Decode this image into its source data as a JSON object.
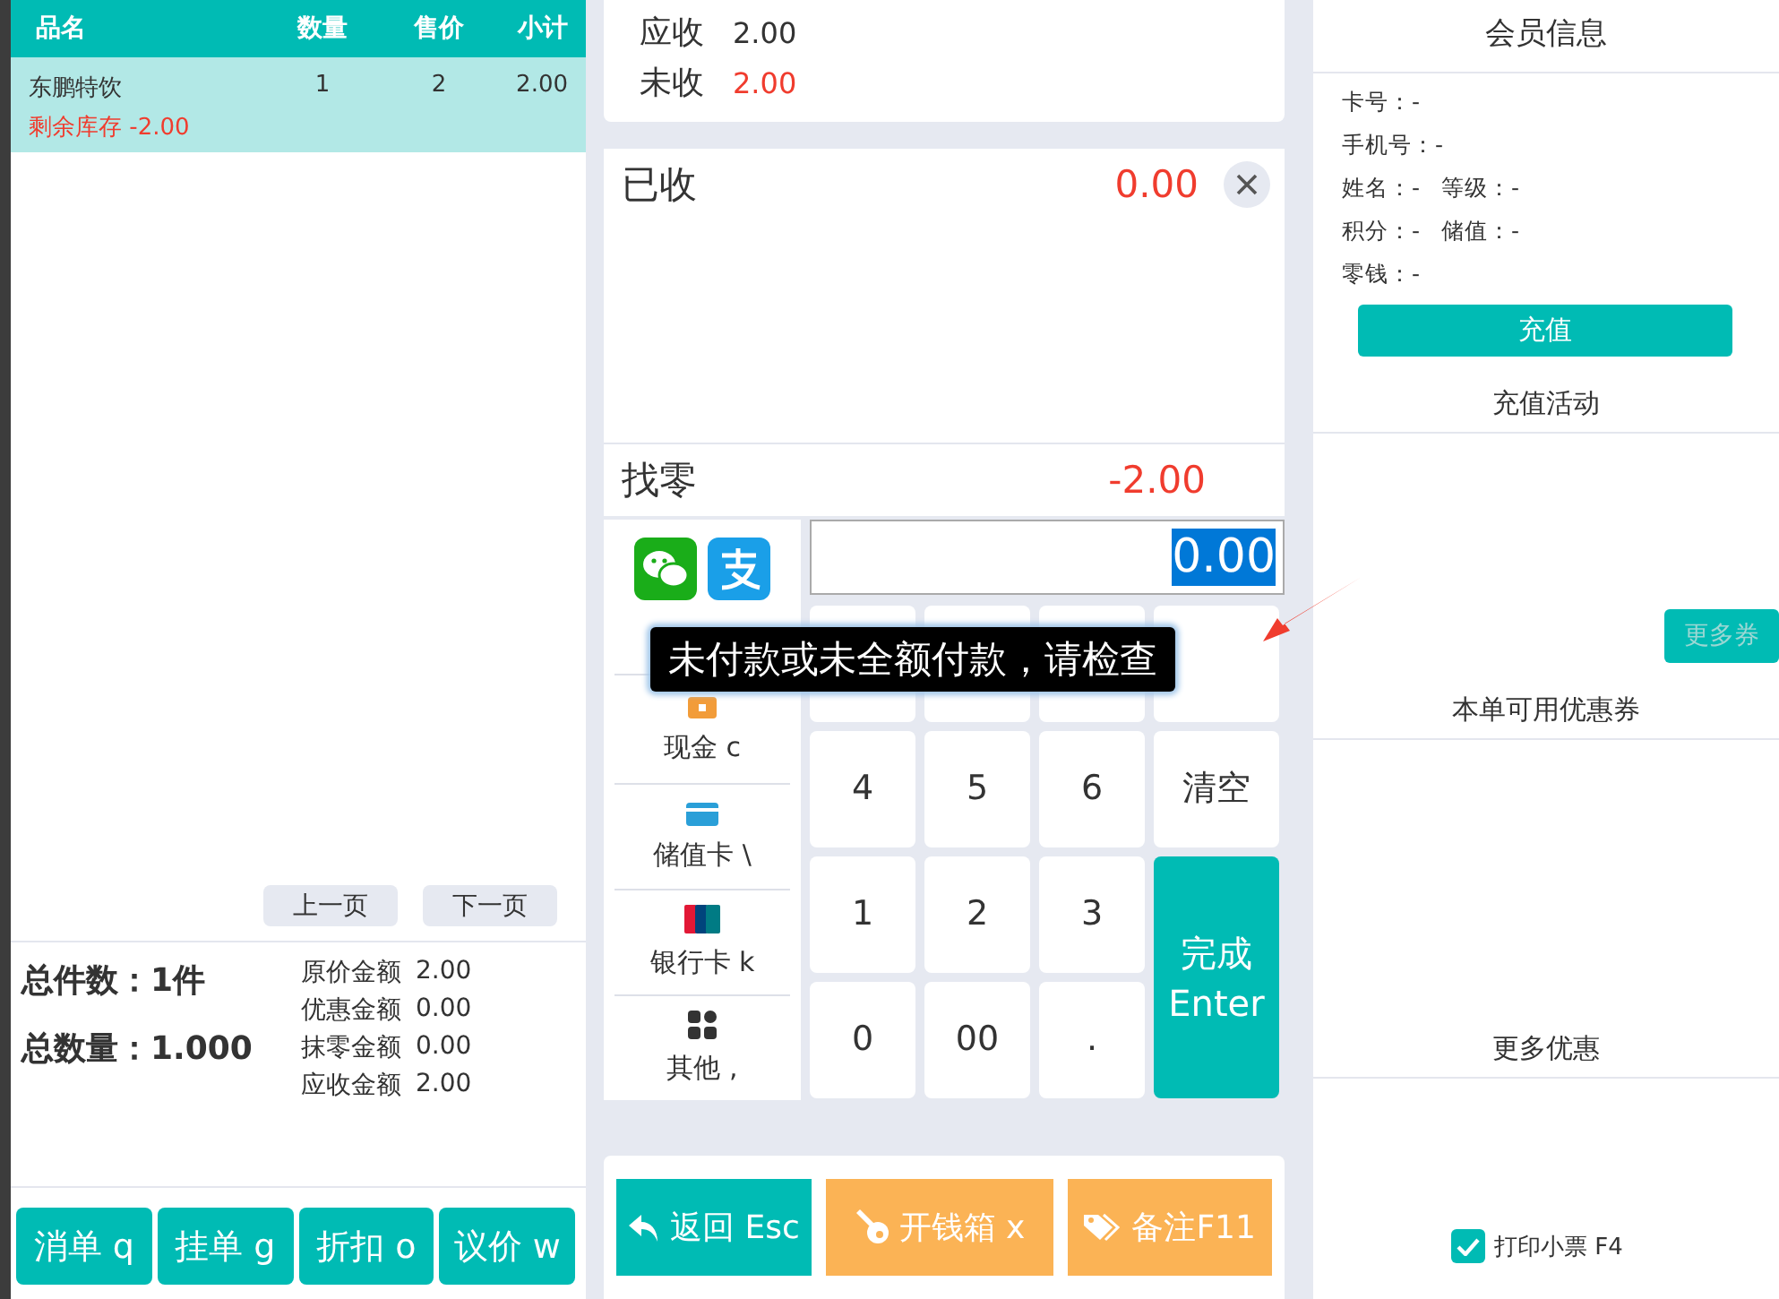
{
  "cart": {
    "columns": [
      "品名",
      "数量",
      "售价",
      "小计"
    ],
    "rows": [
      {
        "name": "东鹏特饮",
        "qty": "1",
        "price": "2",
        "subtotal": "2.00",
        "stock": "剩余库存 -2.00",
        "selected": true
      }
    ],
    "pager": [
      "上一页",
      "下一页"
    ]
  },
  "totals": {
    "count": "总件数：1件",
    "quantity": "总数量：1.000",
    "amounts": [
      {
        "label": "原价金额",
        "value": "2.00"
      },
      {
        "label": "优惠金额",
        "value": "0.00"
      },
      {
        "label": "抹零金额",
        "value": "0.00"
      },
      {
        "label": "应收金额",
        "value": "2.00"
      }
    ]
  },
  "actions": [
    "消单 q",
    "挂单 g",
    "折扣 o",
    "议价 w"
  ],
  "due": [
    {
      "label": "应收",
      "value": "2.00",
      "alert": false
    },
    {
      "label": "未收",
      "value": "2.00",
      "alert": true
    }
  ],
  "received": {
    "label": "已收",
    "value": "0.00"
  },
  "change": {
    "label": "找零",
    "value": "-2.00"
  },
  "methods": [
    {
      "kind": "scan"
    },
    {
      "kind": "cash",
      "label": "现金 c"
    },
    {
      "kind": "card",
      "label": "储值卡 \\"
    },
    {
      "kind": "bank",
      "label": "银行卡 k"
    },
    {
      "kind": "other",
      "label": "其他 ,"
    }
  ],
  "amount_input": {
    "value": "0.00"
  },
  "keypad": [
    {
      "kind": "hidden"
    },
    {
      "kind": "hidden"
    },
    {
      "kind": "hidden"
    },
    {
      "kind": "hidden"
    },
    {
      "kind": "key",
      "label": "4"
    },
    {
      "kind": "key",
      "label": "5"
    },
    {
      "kind": "key",
      "label": "6"
    },
    {
      "kind": "key",
      "label": "清空"
    },
    {
      "kind": "key",
      "label": "1"
    },
    {
      "kind": "key",
      "label": "2"
    },
    {
      "kind": "key",
      "label": "3"
    },
    {
      "kind": "submit",
      "label": "完成\nEnter"
    },
    {
      "kind": "key",
      "label": "0"
    },
    {
      "kind": "key",
      "label": "00"
    },
    {
      "kind": "key",
      "label": "."
    }
  ],
  "tooltip": "未付款或未全额付款，请检查",
  "footer_buttons": [
    {
      "kind": "back",
      "label": "返回 Esc"
    },
    {
      "kind": "drawer",
      "label": "开钱箱 x"
    },
    {
      "kind": "note",
      "label": "备注F11"
    }
  ],
  "member": {
    "title": "会员信息",
    "fields": [
      [
        "卡号：-"
      ],
      [
        "手机号：-"
      ],
      [
        "姓名：-",
        "等级：-"
      ],
      [
        "积分：-",
        "储值：-"
      ],
      [
        "零钱：-"
      ]
    ],
    "recharge": "充值",
    "recharge_activity": "充值活动",
    "more_coupons": "更多券",
    "coupons": "本单可用优惠券",
    "more_offers": "更多优惠",
    "print": {
      "label": "打印小票 F4",
      "checked": true
    }
  }
}
